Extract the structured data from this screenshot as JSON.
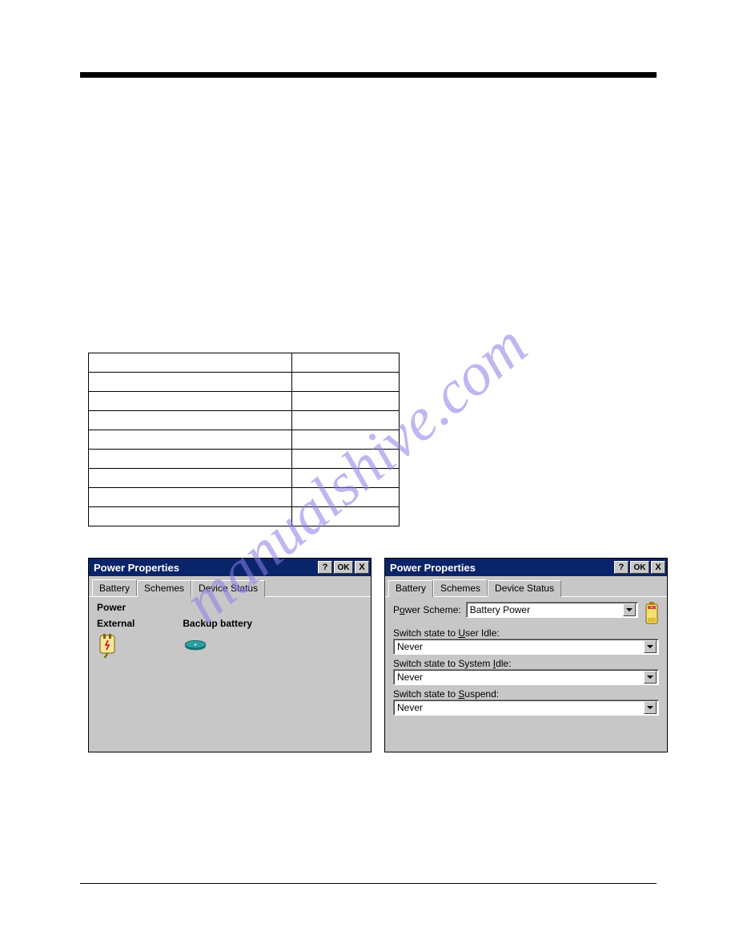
{
  "watermark": {
    "text": "manualshive.com",
    "color": "#8a7de8"
  },
  "dialog1": {
    "title": "Power Properties",
    "help": "?",
    "ok": "OK",
    "close": "X",
    "tabs": {
      "battery": "Battery",
      "schemes": "Schemes",
      "device": "Device Status"
    },
    "power_label": "Power",
    "external_label": "External",
    "backup_label": "Backup battery"
  },
  "dialog2": {
    "title": "Power Properties",
    "help": "?",
    "ok": "OK",
    "close": "X",
    "tabs": {
      "battery": "Battery",
      "schemes": "Schemes",
      "device": "Device Status"
    },
    "power_scheme_label_pre": "P",
    "power_scheme_label_under": "o",
    "power_scheme_label_post": "wer Scheme:",
    "power_scheme_value": "Battery Power",
    "user_idle_pre": "Switch state to ",
    "user_idle_under": "U",
    "user_idle_post": "ser Idle:",
    "user_idle_value": "Never",
    "system_idle_pre": "Switch state to System ",
    "system_idle_under": "I",
    "system_idle_post": "dle:",
    "system_idle_value": "Never",
    "suspend_pre": "Switch state to ",
    "suspend_under": "S",
    "suspend_post": "uspend:",
    "suspend_value": "Never"
  }
}
